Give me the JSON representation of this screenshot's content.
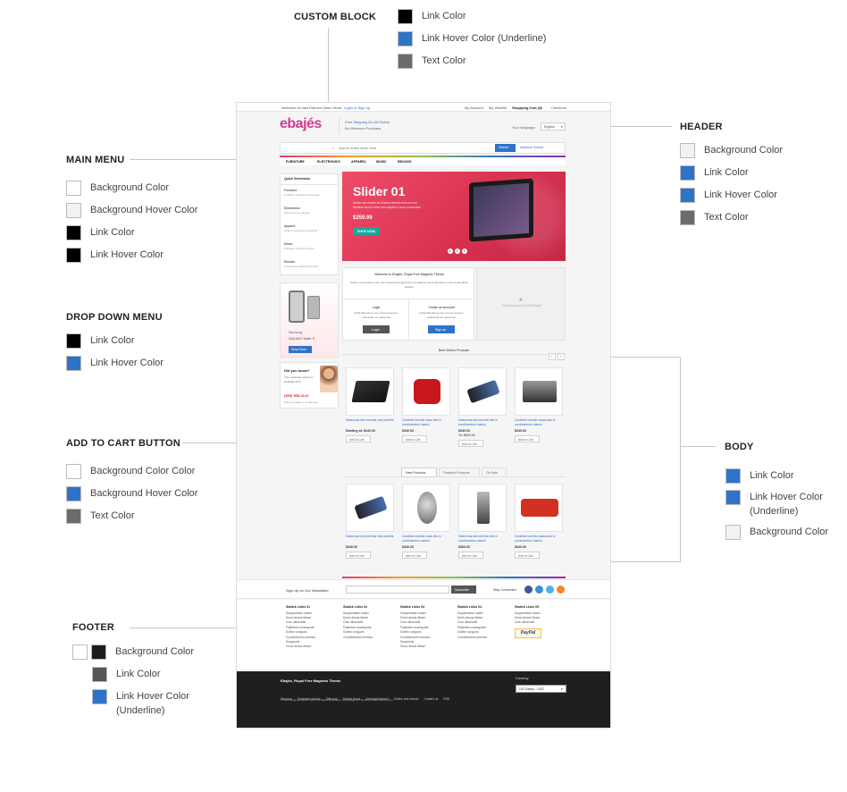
{
  "annotations": {
    "custom_block": {
      "title": "CUSTOM BLOCK"
    },
    "custom_swatches": [
      {
        "label": "Link Color",
        "color": "#000000"
      },
      {
        "label": "Link Hover Color (Underline)",
        "color": "#2f73c8"
      },
      {
        "label": "Text Color",
        "color": "#6b6b6b"
      }
    ],
    "header": {
      "title": "HEADER",
      "swatches": [
        {
          "label": "Background Color",
          "color": "#f2f2f2"
        },
        {
          "label": "Link Color",
          "color": "#2f73c8"
        },
        {
          "label": "Link Hover Color",
          "color": "#2f73c8"
        },
        {
          "label": "Text Color",
          "color": "#6b6b6b"
        }
      ]
    },
    "main_menu": {
      "title": "MAIN MENU",
      "swatches": [
        {
          "label": "Background Color",
          "color": "#ffffff"
        },
        {
          "label": "Background Hover Color",
          "color": "#f2f2f2"
        },
        {
          "label": "Link Color",
          "color": "#000000"
        },
        {
          "label": "Link Hover Color",
          "color": "#000000"
        }
      ]
    },
    "drop_down_menu": {
      "title": "DROP DOWN MENU",
      "swatches": [
        {
          "label": "Link Color",
          "color": "#000000"
        },
        {
          "label": "Link Hover Color",
          "color": "#2f73c8"
        }
      ]
    },
    "add_to_cart": {
      "title": "ADD TO CART BUTTON",
      "swatches": [
        {
          "label": "Background  Color Color",
          "color": "#ffffff"
        },
        {
          "label": "Background Hover Color",
          "color": "#2f73c8"
        },
        {
          "label": "Text Color",
          "color": "#6b6b6b"
        }
      ]
    },
    "body": {
      "title": "BODY",
      "swatches": [
        {
          "label": "Link Color",
          "color": "#2f73c8"
        },
        {
          "label": "Link Hover Color\n(Underline)",
          "color": "#2f73c8"
        },
        {
          "label": "Background Color",
          "color": "#f2f2f2"
        }
      ]
    },
    "footer": {
      "title": "FOOTER",
      "background_colors": [
        "#ffffff",
        "#1c1c1c"
      ],
      "background_label": "Background Color",
      "swatches": [
        {
          "label": "Link Color",
          "color": "#555555"
        },
        {
          "label": "Link Hover Color\n(Underline)",
          "color": "#2f73c8"
        }
      ]
    }
  },
  "site": {
    "topbar": {
      "welcome": "Welcome to HaloThemes Demo Store,",
      "login_link": "Login or Sign up",
      "links": [
        "My Account",
        "My Wishlist",
        "Shopping Cart (2)",
        "Checkout"
      ]
    },
    "logo": "ebajés",
    "shipping": {
      "line1": "Free Shipping On All Orders",
      "line2": "No Minimum Purchase"
    },
    "language": {
      "label": "Your language:",
      "value": "English"
    },
    "search": {
      "placeholder": "search entire store here",
      "button": "Search",
      "advanced": "Advance Search"
    },
    "menu": [
      "FURNITURE",
      "ELECTRONICS",
      "APPAREL",
      "MUSIC",
      "EBOOKS"
    ],
    "quick_selections": {
      "title": "Quick Selections",
      "items": [
        {
          "name": "Furniture",
          "desc": "Curabitur lobortis massa vitae"
        },
        {
          "name": "Electronics",
          "desc": "Aliquam erat volutpat"
        },
        {
          "name": "Apparel",
          "desc": "Nullam consectetur dapibus"
        },
        {
          "name": "Music",
          "desc": "Praesent suscipit semper"
        },
        {
          "name": "Ebooks",
          "desc": "Consectetur adipiscing elitna"
        }
      ]
    },
    "side_ad": {
      "brand": "Samsung",
      "model": "GALAXY Note II",
      "button": "Shop Now"
    },
    "did_you_know": {
      "title": "Did you know?",
      "text": "Your customer service is available 24x7",
      "phone": "(555) 555-0123",
      "sub": "Visit us, today or on the way"
    },
    "slider": {
      "title": "Slider 01",
      "text": "Donec non mauris mi vivamus lacinia enim nec dui tincidunt auctor tellus enim dapibus, lacus consectetur",
      "price": "$259.99",
      "button": "SHOP NOW",
      "dots": [
        "1",
        "2",
        "3"
      ]
    },
    "welcome_box": {
      "title": "Welcome to Ebajés, Royal Free Magento Theme",
      "text": "Nullam consectetur justo nec imperdiet feugiat felis erat dapibus turpis dignissim porta suspendisse facilisis"
    },
    "login_box": {
      "title": "Login",
      "text": "Nulla bibendum eros a lorem tempus sollicitudin at maecenas",
      "button": "Login"
    },
    "create_box": {
      "title": "Create an Account",
      "text": "Nulla bibendum eros a lorem tempus sollicitudin at maecenas",
      "button": "Sign up"
    },
    "advert": {
      "text": "Advertisement (300x250px)"
    },
    "best_sellers": {
      "title": "Best Sellers Products",
      "products": [
        {
          "name": "Maecenas des lorenms mas scelerts",
          "price": "Starting at: $340.00",
          "button": "Add to Cart"
        },
        {
          "name": "Curabitur lobortis mass des in condimentum mauris",
          "price": "$340.00",
          "button": "Add to Cart"
        },
        {
          "name": "Maecenas des lorenms des in condimentum mauris",
          "price": "$340.00",
          "price2": "To: $600.00",
          "button": "Add to Cart"
        },
        {
          "name": "Curabitur lobortis massa des in condimentum mauris",
          "price": "$340.00",
          "button": "Add to Cart"
        }
      ]
    },
    "tabs": [
      "New Products",
      "Featured Products",
      "On Sale"
    ],
    "new_products": [
      {
        "name": "Maecenas des lorenms mas scelerts",
        "price": "$340.00",
        "button": "Add to Cart"
      },
      {
        "name": "Curabitur lobortis mass des in condimentum mauris",
        "price": "$340.00",
        "button": "Add to Cart"
      },
      {
        "name": "Maecenas des lorenms des in condimentum mauris",
        "price": "$300.00",
        "button": "Add to Cart"
      },
      {
        "name": "Curabitur lobortis massa des in condimentum mauris",
        "price": "$340.00",
        "button": "Add to Cart"
      }
    ],
    "newsletter": {
      "label": "Sign Up for Our Newsletter",
      "button": "Subscribe",
      "stay": "Stay Connected"
    },
    "static_links": [
      {
        "title": "Statick Links 01",
        "items": [
          "Suspendisse nodes",
          "Dooic deaus libram",
          "Cras denenatis",
          "Palientes consequate",
          "Sollem congues",
          "Condimentum emmica",
          "Suspendis",
          "Dooic deaus libram"
        ]
      },
      {
        "title": "Statick Links 02",
        "items": [
          "Suspendisse nodes",
          "Dooic deaus libram",
          "Cras denenatis",
          "Palientes consequate",
          "Sollem congues",
          "Condimentum emmica"
        ]
      },
      {
        "title": "Statick Links 03",
        "items": [
          "Suspendisse nodes",
          "Dooic deaus libram",
          "Cras denenatis",
          "Palientes consequate",
          "Sollem congues",
          "Condimentum emmica",
          "Suspendis",
          "Dooic deaus libram"
        ]
      },
      {
        "title": "Statick Links 04",
        "items": [
          "Suspendisse nodes",
          "Dooic deaus libram",
          "Cras denenatis",
          "Palientes consequate",
          "Sollem congues",
          "Condimentum emmica"
        ]
      },
      {
        "title": "Statick Links 05",
        "items": [
          "Suspendisse nodes",
          "Dooic deaus libram",
          "Cras denenatis"
        ],
        "badge": "PayPal"
      }
    ],
    "footer": {
      "title": "Ebajés, Royal Free Magento Theme",
      "links": [
        "About us",
        "Customer service",
        "Site map",
        "Search terms",
        "Advanced search",
        "Orders and returns",
        "Contact us",
        "RSS"
      ],
      "copyright": "© 2012 Magento Demo Store. All Rights Reserved. Free Magento Theme by HaloThemes.com",
      "currency_label": "Currency",
      "currency_value": "US Dollars - USD"
    }
  }
}
